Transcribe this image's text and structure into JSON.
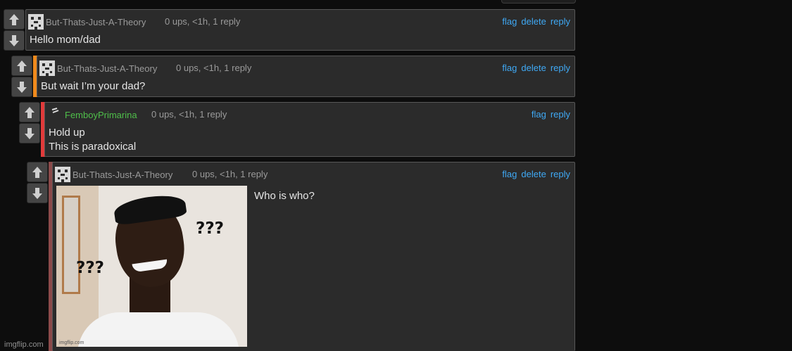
{
  "comments": [
    {
      "username": "But-Thats-Just-A-Theory",
      "meta": "0 ups, <1h, 1 reply",
      "actions": [
        "flag",
        "delete",
        "reply"
      ],
      "text_lines": [
        "Hello mom/dad"
      ],
      "username_color": "#9a9a9a",
      "accent_color": null,
      "avatar_icon": "pixel-face-icon"
    },
    {
      "username": "But-Thats-Just-A-Theory",
      "meta": "0 ups, <1h, 1 reply",
      "actions": [
        "flag",
        "delete",
        "reply"
      ],
      "text_lines": [
        "But wait I’m your dad?"
      ],
      "username_color": "#9a9a9a",
      "accent_color": "#f08a1c",
      "avatar_icon": "pixel-face-icon"
    },
    {
      "username": "FemboyPrimarina",
      "meta": "0 ups, <1h, 1 reply",
      "actions": [
        "flag",
        "reply"
      ],
      "text_lines": [
        "Hold up",
        "This is paradoxical"
      ],
      "username_color": "#4fbf4a",
      "accent_color": "#e23b3b",
      "avatar_icon": "squiggle-icon"
    },
    {
      "username": "But-Thats-Just-A-Theory",
      "meta": "0 ups, <1h, 1 reply",
      "actions": [
        "flag",
        "delete",
        "reply"
      ],
      "text_lines": [
        "Who is who?"
      ],
      "username_color": "#9a9a9a",
      "accent_color": "#8b4a4a",
      "avatar_icon": "pixel-face-icon",
      "image_caption_left": "???",
      "image_caption_right": "???",
      "image_watermark": "imgflip.com"
    }
  ],
  "footer_watermark": "imgflip.com",
  "colors": {
    "link": "#3fa9f5",
    "background": "#0d0d0d",
    "panel": "#2b2b2b"
  }
}
